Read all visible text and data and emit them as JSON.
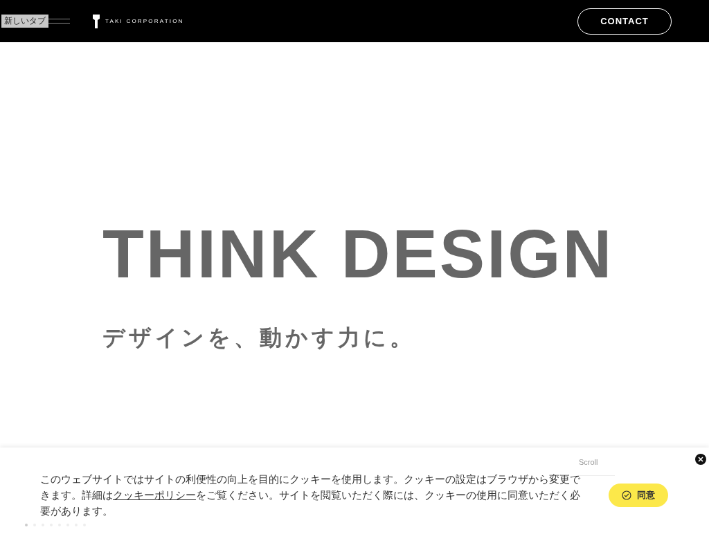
{
  "header": {
    "tab_label": "新しいタブ",
    "logo_text": "TAKI CORPORATION",
    "contact_button": "CONTACT"
  },
  "hero": {
    "title": "THINK DESIGN",
    "subtitle": "デザインを、動かす力に。"
  },
  "scroll_label": "Scroll",
  "slides": [
    {
      "selected": true
    },
    {
      "selected": false
    },
    {
      "selected": false
    },
    {
      "selected": false
    },
    {
      "selected": false
    },
    {
      "selected": false
    },
    {
      "selected": false
    },
    {
      "selected": false
    }
  ],
  "cookie_banner": {
    "text_before": "このウェブサイトではサイトの利便性の向上を目的にクッキーを使用します。クッキーの設定はブラウザから変更できます。詳細は",
    "link": "クッキーポリシー",
    "text_after": "をご覧ください。サイトを閲覧いただく際には、クッキーの使用に同意いただく必要があります。",
    "agree_button": "同意"
  }
}
